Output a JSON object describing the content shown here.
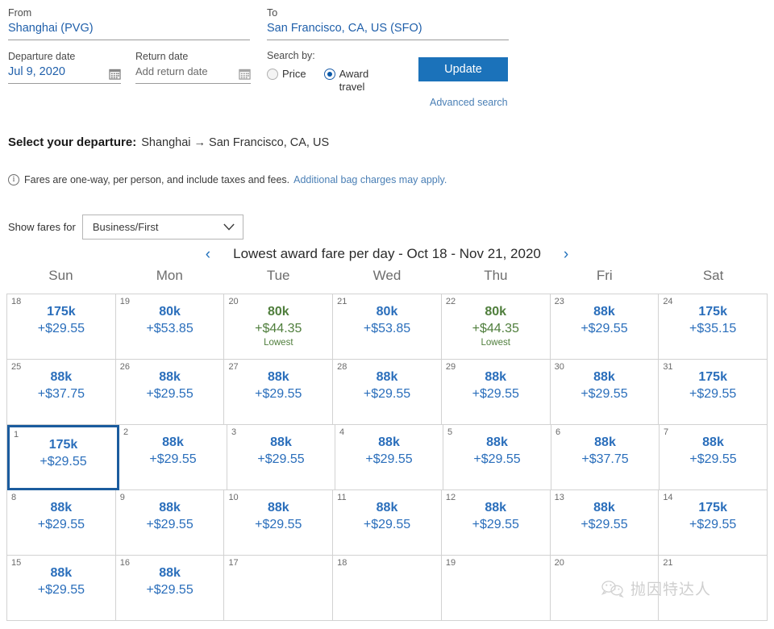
{
  "search": {
    "from_label": "From",
    "from_value": "Shanghai (PVG)",
    "to_label": "To",
    "to_value": "San Francisco, CA, US (SFO)",
    "departure_label": "Departure date",
    "departure_value": "Jul 9, 2020",
    "return_label": "Return date",
    "return_placeholder": "Add return date",
    "searchby_label": "Search by:",
    "radio_price": "Price",
    "radio_award": "Award travel",
    "selected_radio": "award",
    "update_button": "Update",
    "advanced_search": "Advanced search"
  },
  "departure": {
    "heading": "Select your departure:",
    "route": "Shanghai → San Francisco, CA, US",
    "fares_note": "Fares are one-way, per person, and include taxes and fees.",
    "fares_link": "Additional bag charges may apply."
  },
  "show_fares": {
    "label": "Show fares for",
    "selected": "Business/First"
  },
  "calendar": {
    "title": "Lowest award fare per day - Oct 18 - Nov 21, 2020",
    "prev_arrow": "‹",
    "next_arrow": "›",
    "dow": [
      "Sun",
      "Mon",
      "Tue",
      "Wed",
      "Thu",
      "Fri",
      "Sat"
    ],
    "lowest_tag": "Lowest",
    "selected_day": "1",
    "rows": [
      [
        {
          "day": "18",
          "miles": "175k",
          "tax": "+$29.55",
          "lowest": false
        },
        {
          "day": "19",
          "miles": "80k",
          "tax": "+$53.85",
          "lowest": false
        },
        {
          "day": "20",
          "miles": "80k",
          "tax": "+$44.35",
          "lowest": true
        },
        {
          "day": "21",
          "miles": "80k",
          "tax": "+$53.85",
          "lowest": false
        },
        {
          "day": "22",
          "miles": "80k",
          "tax": "+$44.35",
          "lowest": true
        },
        {
          "day": "23",
          "miles": "88k",
          "tax": "+$29.55",
          "lowest": false
        },
        {
          "day": "24",
          "miles": "175k",
          "tax": "+$35.15",
          "lowest": false
        }
      ],
      [
        {
          "day": "25",
          "miles": "88k",
          "tax": "+$37.75",
          "lowest": false
        },
        {
          "day": "26",
          "miles": "88k",
          "tax": "+$29.55",
          "lowest": false
        },
        {
          "day": "27",
          "miles": "88k",
          "tax": "+$29.55",
          "lowest": false
        },
        {
          "day": "28",
          "miles": "88k",
          "tax": "+$29.55",
          "lowest": false
        },
        {
          "day": "29",
          "miles": "88k",
          "tax": "+$29.55",
          "lowest": false
        },
        {
          "day": "30",
          "miles": "88k",
          "tax": "+$29.55",
          "lowest": false
        },
        {
          "day": "31",
          "miles": "175k",
          "tax": "+$29.55",
          "lowest": false
        }
      ],
      [
        {
          "day": "1",
          "miles": "175k",
          "tax": "+$29.55",
          "lowest": false,
          "selected": true
        },
        {
          "day": "2",
          "miles": "88k",
          "tax": "+$29.55",
          "lowest": false
        },
        {
          "day": "3",
          "miles": "88k",
          "tax": "+$29.55",
          "lowest": false
        },
        {
          "day": "4",
          "miles": "88k",
          "tax": "+$29.55",
          "lowest": false
        },
        {
          "day": "5",
          "miles": "88k",
          "tax": "+$29.55",
          "lowest": false
        },
        {
          "day": "6",
          "miles": "88k",
          "tax": "+$37.75",
          "lowest": false
        },
        {
          "day": "7",
          "miles": "88k",
          "tax": "+$29.55",
          "lowest": false
        }
      ],
      [
        {
          "day": "8",
          "miles": "88k",
          "tax": "+$29.55",
          "lowest": false
        },
        {
          "day": "9",
          "miles": "88k",
          "tax": "+$29.55",
          "lowest": false
        },
        {
          "day": "10",
          "miles": "88k",
          "tax": "+$29.55",
          "lowest": false
        },
        {
          "day": "11",
          "miles": "88k",
          "tax": "+$29.55",
          "lowest": false
        },
        {
          "day": "12",
          "miles": "88k",
          "tax": "+$29.55",
          "lowest": false
        },
        {
          "day": "13",
          "miles": "88k",
          "tax": "+$29.55",
          "lowest": false
        },
        {
          "day": "14",
          "miles": "175k",
          "tax": "+$29.55",
          "lowest": false
        }
      ],
      [
        {
          "day": "15",
          "miles": "88k",
          "tax": "+$29.55",
          "lowest": false
        },
        {
          "day": "16",
          "miles": "88k",
          "tax": "+$29.55",
          "lowest": false
        },
        {
          "day": "17",
          "miles": "",
          "tax": "",
          "lowest": false
        },
        {
          "day": "18",
          "miles": "",
          "tax": "",
          "lowest": false
        },
        {
          "day": "19",
          "miles": "",
          "tax": "",
          "lowest": false
        },
        {
          "day": "20",
          "miles": "",
          "tax": "",
          "lowest": false
        },
        {
          "day": "21",
          "miles": "",
          "tax": "",
          "lowest": false
        }
      ]
    ]
  },
  "watermark": {
    "text": "抛因特达人",
    "icon": "wechat-icon"
  },
  "colors": {
    "link": "#2a6ebb",
    "button": "#1b72ba",
    "lowest": "#4f7e3c",
    "selected_border": "#1b5c9e"
  }
}
